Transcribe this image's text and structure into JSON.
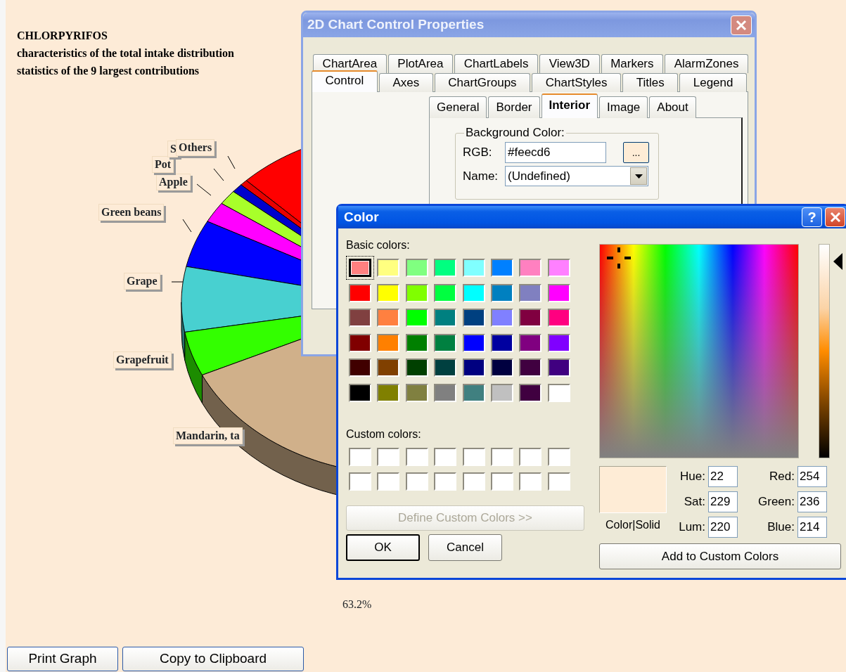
{
  "page": {
    "title_lines": [
      "CHLORPYRIFOS",
      "characteristics of the total intake distribution",
      "statistics of the 9 largest contributions"
    ],
    "chart": {
      "slices": [
        {
          "color": "#ff0000"
        },
        {
          "label": "Others",
          "color": "#e80000"
        },
        {
          "label": "S",
          "color": "#0000cc"
        },
        {
          "label": "Pot",
          "color": "#a8ff2a"
        },
        {
          "label": "Apple",
          "color": "#ff00ff"
        },
        {
          "label": "Green beans",
          "color": "#0000ff"
        },
        {
          "label": "Grape",
          "color": "#48d0d0"
        },
        {
          "label": "Grapefruit",
          "color": "#33ff00"
        },
        {
          "label": "Mandarin, ta",
          "color": "#d0b08a"
        }
      ],
      "value_label": "63.2%"
    },
    "buttons": [
      "Print Graph",
      "Copy to Clipboard"
    ]
  },
  "properties_dialog": {
    "title": "2D Chart Control Properties",
    "tab_rows": [
      [
        {
          "label": "ChartArea",
          "selected": false
        },
        {
          "label": "PlotArea",
          "selected": false
        },
        {
          "label": "ChartLabels",
          "selected": false
        },
        {
          "label": "View3D",
          "selected": false
        },
        {
          "label": "Markers",
          "selected": false
        },
        {
          "label": "AlarmZones",
          "selected": false
        }
      ],
      [
        {
          "label": "Control",
          "selected": true
        },
        {
          "label": "Axes",
          "selected": false
        },
        {
          "label": "ChartGroups",
          "selected": false
        },
        {
          "label": "ChartStyles",
          "selected": false
        },
        {
          "label": "Titles",
          "selected": false
        },
        {
          "label": "Legend",
          "selected": false
        }
      ]
    ],
    "subtabs": [
      {
        "label": "General",
        "selected": false
      },
      {
        "label": "Border",
        "selected": false
      },
      {
        "label": "Interior",
        "selected": true
      },
      {
        "label": "Image",
        "selected": false
      },
      {
        "label": "About",
        "selected": false
      }
    ],
    "group": {
      "title": "Background Color:",
      "rgb_label": "RGB:",
      "rgb_value": "#feecd6",
      "browse_button": "...",
      "name_label": "Name:",
      "name_value": "(Undefined)"
    }
  },
  "color_dialog": {
    "title": "Color",
    "help_button": "?",
    "basic_colors_label": "Basic colors:",
    "basic_colors": [
      {
        "color": "#ff8080",
        "selected": true
      },
      {
        "color": "#ffff80",
        "selected": false
      },
      {
        "color": "#80ff80",
        "selected": false
      },
      {
        "color": "#00ff80",
        "selected": false
      },
      {
        "color": "#80ffff",
        "selected": false
      },
      {
        "color": "#0080ff",
        "selected": false
      },
      {
        "color": "#ff80c0",
        "selected": false
      },
      {
        "color": "#ff80ff",
        "selected": false
      },
      {
        "color": "#ff0000",
        "selected": false
      },
      {
        "color": "#ffff00",
        "selected": false
      },
      {
        "color": "#80ff00",
        "selected": false
      },
      {
        "color": "#00ff40",
        "selected": false
      },
      {
        "color": "#00ffff",
        "selected": false
      },
      {
        "color": "#0080c0",
        "selected": false
      },
      {
        "color": "#8080c0",
        "selected": false
      },
      {
        "color": "#ff00ff",
        "selected": false
      },
      {
        "color": "#804040",
        "selected": false
      },
      {
        "color": "#ff8040",
        "selected": false
      },
      {
        "color": "#00ff00",
        "selected": false
      },
      {
        "color": "#008080",
        "selected": false
      },
      {
        "color": "#004080",
        "selected": false
      },
      {
        "color": "#8080ff",
        "selected": false
      },
      {
        "color": "#800040",
        "selected": false
      },
      {
        "color": "#ff0080",
        "selected": false
      },
      {
        "color": "#800000",
        "selected": false
      },
      {
        "color": "#ff8000",
        "selected": false
      },
      {
        "color": "#008000",
        "selected": false
      },
      {
        "color": "#008040",
        "selected": false
      },
      {
        "color": "#0000ff",
        "selected": false
      },
      {
        "color": "#0000a0",
        "selected": false
      },
      {
        "color": "#800080",
        "selected": false
      },
      {
        "color": "#8000ff",
        "selected": false
      },
      {
        "color": "#400000",
        "selected": false
      },
      {
        "color": "#804000",
        "selected": false
      },
      {
        "color": "#004000",
        "selected": false
      },
      {
        "color": "#004040",
        "selected": false
      },
      {
        "color": "#000080",
        "selected": false
      },
      {
        "color": "#000040",
        "selected": false
      },
      {
        "color": "#400040",
        "selected": false
      },
      {
        "color": "#400080",
        "selected": false
      },
      {
        "color": "#000000",
        "selected": false
      },
      {
        "color": "#808000",
        "selected": false
      },
      {
        "color": "#808040",
        "selected": false
      },
      {
        "color": "#808080",
        "selected": false
      },
      {
        "color": "#408080",
        "selected": false
      },
      {
        "color": "#c0c0c0",
        "selected": false
      },
      {
        "color": "#400040",
        "selected": false
      },
      {
        "color": "#ffffff",
        "selected": false
      }
    ],
    "custom_colors_label": "Custom colors:",
    "custom_colors": [
      {
        "color": "#ffffff"
      },
      {
        "color": "#ffffff"
      },
      {
        "color": "#ffffff"
      },
      {
        "color": "#ffffff"
      },
      {
        "color": "#ffffff"
      },
      {
        "color": "#ffffff"
      },
      {
        "color": "#ffffff"
      },
      {
        "color": "#ffffff"
      },
      {
        "color": "#ffffff"
      },
      {
        "color": "#ffffff"
      },
      {
        "color": "#ffffff"
      },
      {
        "color": "#ffffff"
      },
      {
        "color": "#ffffff"
      },
      {
        "color": "#ffffff"
      },
      {
        "color": "#ffffff"
      },
      {
        "color": "#ffffff"
      }
    ],
    "define_button": {
      "label": "Define Custom Colors >>",
      "disabled": true
    },
    "ok_button": "OK",
    "cancel_button": "Cancel",
    "luminance": {
      "level": 0.92
    },
    "preview_label": "Color|Solid",
    "hsl_fields": [
      {
        "label": "Hue:",
        "value": "22"
      },
      {
        "label": "Sat:",
        "value": "229"
      },
      {
        "label": "Lum:",
        "value": "220"
      }
    ],
    "rgb_fields": [
      {
        "label": "Red:",
        "value": "254"
      },
      {
        "label": "Green:",
        "value": "236"
      },
      {
        "label": "Blue:",
        "value": "214"
      }
    ],
    "add_button": "Add to Custom Colors"
  }
}
